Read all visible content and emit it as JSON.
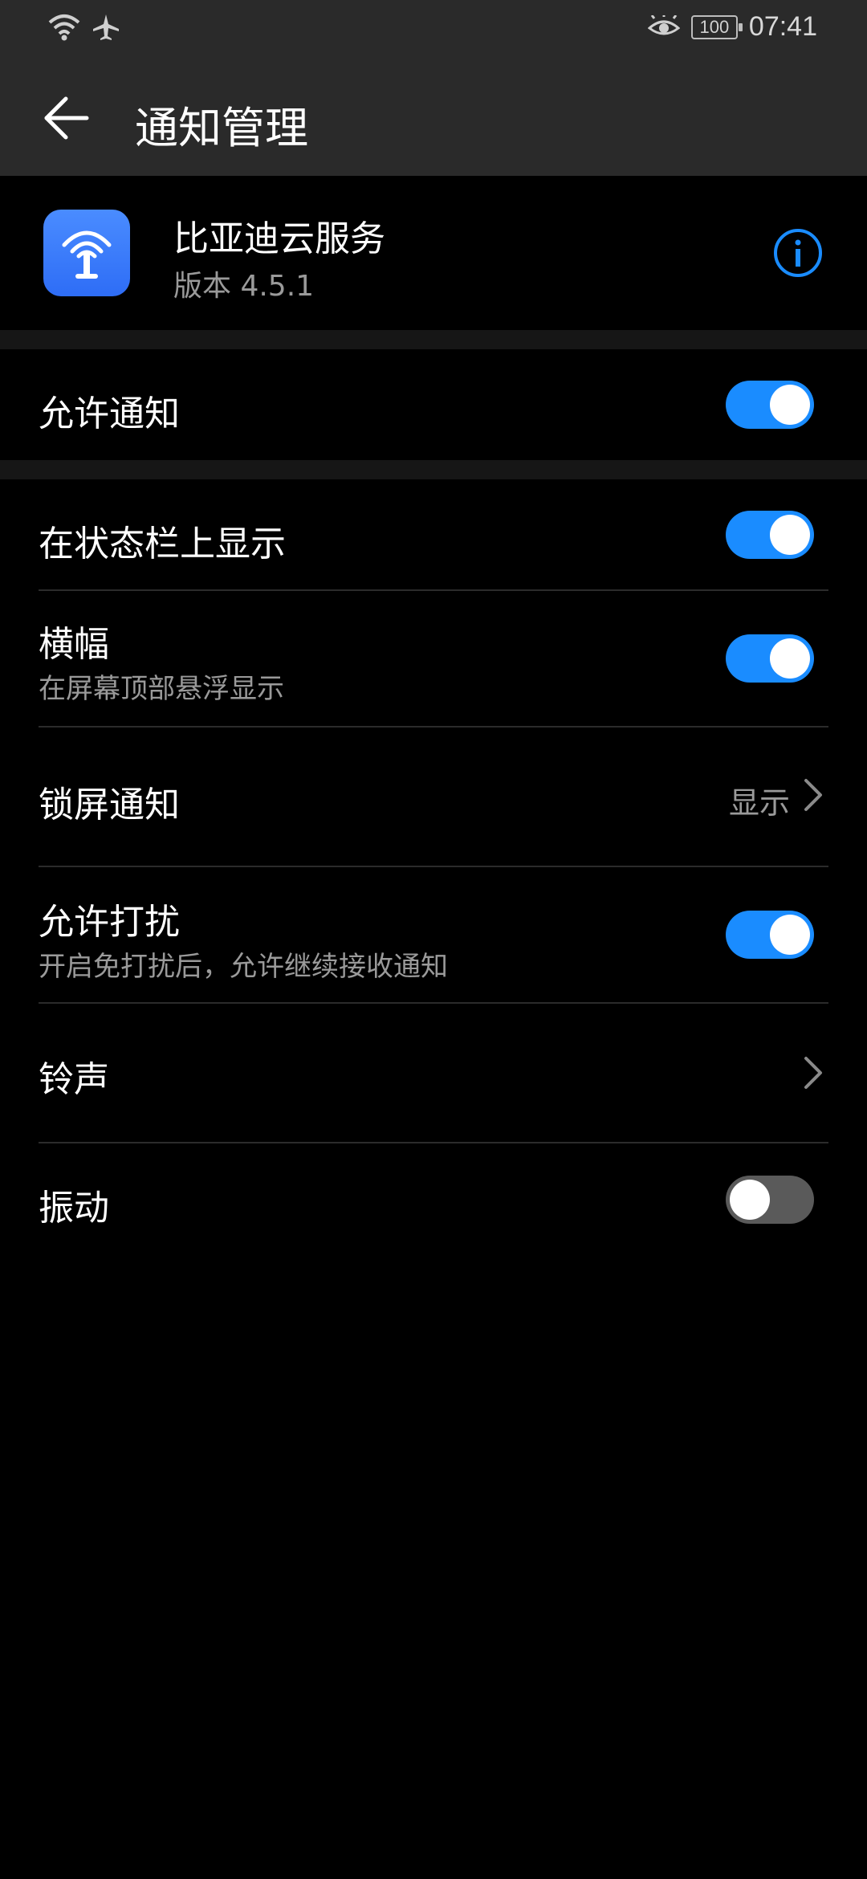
{
  "status_bar": {
    "battery": "100",
    "time": "07:41",
    "icons": [
      "wifi-icon",
      "airplane-icon",
      "eye-comfort-icon",
      "battery-icon"
    ]
  },
  "header": {
    "title": "通知管理",
    "back_icon": "back-arrow-icon"
  },
  "app": {
    "name": "比亚迪云服务",
    "version": "版本 4.5.1",
    "icon_color": "#3478f6",
    "info_icon": "info-icon"
  },
  "settings": {
    "allow_notifications": {
      "label": "允许通知",
      "enabled": true
    },
    "status_bar_display": {
      "label": "在状态栏上显示",
      "enabled": true
    },
    "banner": {
      "label": "横幅",
      "sub": "在屏幕顶部悬浮显示",
      "enabled": true
    },
    "lock_screen": {
      "label": "锁屏通知",
      "value": "显示"
    },
    "allow_dnd": {
      "label": "允许打扰",
      "sub": "开启免打扰后，允许继续接收通知",
      "enabled": true
    },
    "ringtone": {
      "label": "铃声"
    },
    "vibration": {
      "label": "振动",
      "enabled": false
    }
  },
  "colors": {
    "accent": "#1a8cff",
    "background": "#000000",
    "bar": "#2a2a2a",
    "secondary_text": "#9a9a9a"
  }
}
